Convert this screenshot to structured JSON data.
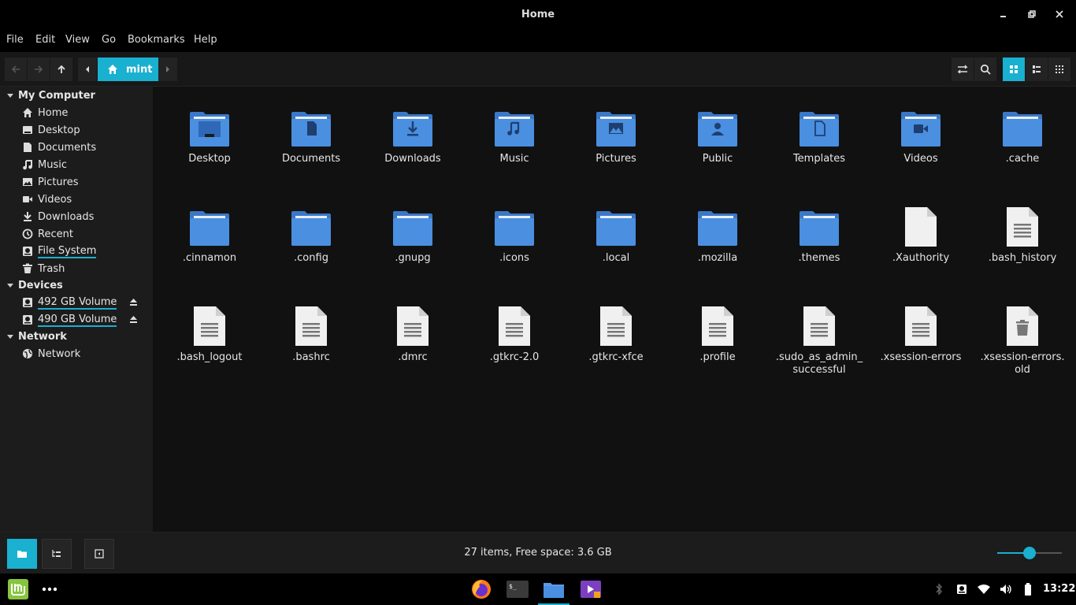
{
  "window": {
    "title": "Home"
  },
  "menu": [
    "File",
    "Edit",
    "View",
    "Go",
    "Bookmarks",
    "Help"
  ],
  "breadcrumb": {
    "label": "mint"
  },
  "sidebar": {
    "sections": [
      {
        "title": "My Computer",
        "items": [
          {
            "label": "Home",
            "icon": "home-icon"
          },
          {
            "label": "Desktop",
            "icon": "desktop-icon"
          },
          {
            "label": "Documents",
            "icon": "document-icon"
          },
          {
            "label": "Music",
            "icon": "music-icon"
          },
          {
            "label": "Pictures",
            "icon": "picture-icon"
          },
          {
            "label": "Videos",
            "icon": "video-icon"
          },
          {
            "label": "Downloads",
            "icon": "download-icon"
          },
          {
            "label": "Recent",
            "icon": "clock-icon"
          },
          {
            "label": "File System",
            "icon": "drive-icon"
          },
          {
            "label": "Trash",
            "icon": "trash-icon"
          }
        ]
      },
      {
        "title": "Devices",
        "items": [
          {
            "label": "492 GB Volume",
            "icon": "drive-icon"
          },
          {
            "label": "490 GB Volume",
            "icon": "drive-icon"
          }
        ]
      },
      {
        "title": "Network",
        "items": [
          {
            "label": "Network",
            "icon": "network-icon"
          }
        ]
      }
    ]
  },
  "files": [
    {
      "name": "Desktop",
      "type": "folder",
      "glyph": "desktop"
    },
    {
      "name": "Documents",
      "type": "folder",
      "glyph": "document"
    },
    {
      "name": "Downloads",
      "type": "folder",
      "glyph": "download"
    },
    {
      "name": "Music",
      "type": "folder",
      "glyph": "music"
    },
    {
      "name": "Pictures",
      "type": "folder",
      "glyph": "picture"
    },
    {
      "name": "Public",
      "type": "folder",
      "glyph": "public"
    },
    {
      "name": "Templates",
      "type": "folder",
      "glyph": "template"
    },
    {
      "name": "Videos",
      "type": "folder",
      "glyph": "video"
    },
    {
      "name": ".cache",
      "type": "folder",
      "glyph": ""
    },
    {
      "name": ".cinnamon",
      "type": "folder",
      "glyph": ""
    },
    {
      "name": ".config",
      "type": "folder",
      "glyph": ""
    },
    {
      "name": ".gnupg",
      "type": "folder",
      "glyph": ""
    },
    {
      "name": ".icons",
      "type": "folder",
      "glyph": ""
    },
    {
      "name": ".local",
      "type": "folder",
      "glyph": ""
    },
    {
      "name": ".mozilla",
      "type": "folder",
      "glyph": ""
    },
    {
      "name": ".themes",
      "type": "folder",
      "glyph": ""
    },
    {
      "name": ".Xauthority",
      "type": "blank",
      "glyph": ""
    },
    {
      "name": ".bash_history",
      "type": "text",
      "glyph": ""
    },
    {
      "name": ".bash_logout",
      "type": "text",
      "glyph": ""
    },
    {
      "name": ".bashrc",
      "type": "text",
      "glyph": ""
    },
    {
      "name": ".dmrc",
      "type": "text",
      "glyph": ""
    },
    {
      "name": ".gtkrc-2.0",
      "type": "text",
      "glyph": ""
    },
    {
      "name": ".gtkrc-xfce",
      "type": "text",
      "glyph": ""
    },
    {
      "name": ".profile",
      "type": "text",
      "glyph": ""
    },
    {
      "name": ".sudo_as_admin_\nsuccessful",
      "type": "text",
      "glyph": ""
    },
    {
      "name": ".xsession-errors",
      "type": "text",
      "glyph": ""
    },
    {
      "name": ".xsession-errors.\nold",
      "type": "trashfile",
      "glyph": ""
    }
  ],
  "status": {
    "text": "27 items, Free space: 3.6 GB",
    "zoom_fraction": 0.5
  },
  "taskbar": {
    "clock": "13:22"
  },
  "colors": {
    "accent": "#1ab0d0",
    "folder": "#4a8fe0",
    "folder_tab": "#3a78c8"
  }
}
